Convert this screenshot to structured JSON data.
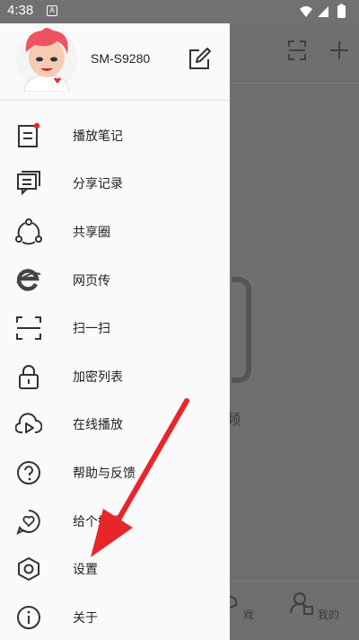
{
  "status_bar": {
    "time": "4:38",
    "notification_letter": "A"
  },
  "background_app": {
    "center_text": "频",
    "tab_partial_label": "戏",
    "tab_mine_label": "我的"
  },
  "drawer": {
    "device_name": "SM-S9280",
    "menu": [
      {
        "label": "播放笔记",
        "icon": "note-icon"
      },
      {
        "label": "分享记录",
        "icon": "share-record-icon"
      },
      {
        "label": "共享圈",
        "icon": "share-circle-icon"
      },
      {
        "label": "网页传",
        "icon": "web-transfer-icon"
      },
      {
        "label": "扫一扫",
        "icon": "scan-icon"
      },
      {
        "label": "加密列表",
        "icon": "lock-icon"
      },
      {
        "label": "在线播放",
        "icon": "online-play-icon"
      },
      {
        "label": "帮助与反馈",
        "icon": "help-icon"
      },
      {
        "label": "给个好评",
        "icon": "heart-bubble-icon"
      },
      {
        "label": "设置",
        "icon": "settings-icon"
      },
      {
        "label": "关于",
        "icon": "info-icon"
      }
    ]
  },
  "colors": {
    "accent_red": "#e8262a",
    "scrim": "#6f6f6f",
    "drawer_bg": "#fafafa"
  }
}
